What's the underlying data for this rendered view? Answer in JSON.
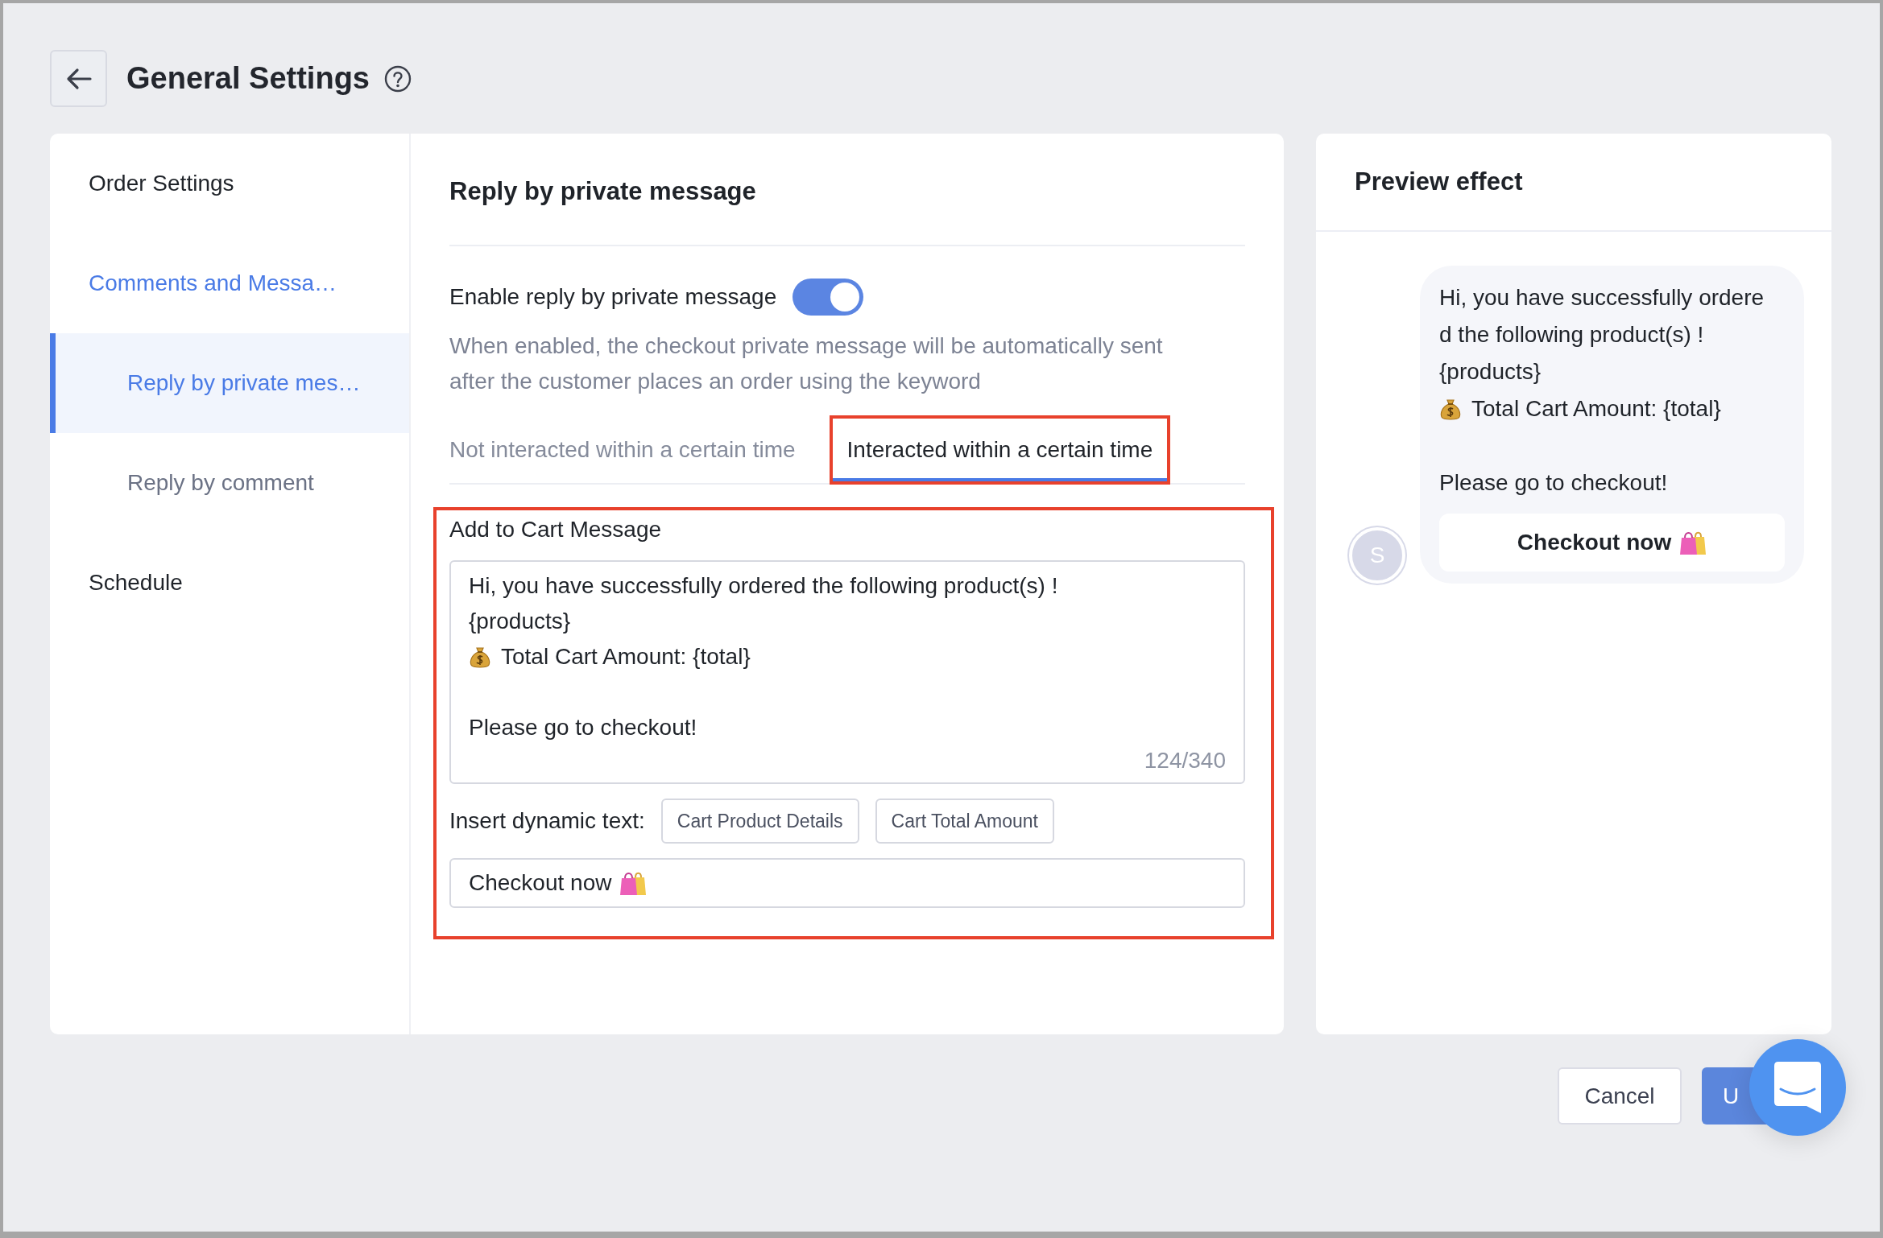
{
  "header": {
    "title": "General Settings"
  },
  "sidebar": {
    "items": [
      {
        "label": "Order Settings",
        "kind": "group",
        "selected": false
      },
      {
        "label": "Comments and Messa…",
        "kind": "group-active",
        "selected": false
      },
      {
        "label": "Reply by private mes…",
        "kind": "sub",
        "selected": true
      },
      {
        "label": "Reply by comment",
        "kind": "sub",
        "selected": false
      },
      {
        "label": "Schedule",
        "kind": "group",
        "selected": false
      }
    ]
  },
  "content": {
    "title": "Reply by private message",
    "toggle": {
      "label": "Enable reply by private message",
      "on": true
    },
    "description": [
      "When enabled, the checkout private message will be automatically sent",
      "after the customer places an order using the keyword"
    ],
    "tabs": [
      {
        "label": "Not interacted within a certain time",
        "selected": false,
        "highlighted": false
      },
      {
        "label": "Interacted within a certain time",
        "selected": true,
        "highlighted": true
      }
    ],
    "cart_message": {
      "label": "Add to Cart Message",
      "highlighted": true,
      "lines": [
        {
          "kind": "text",
          "text": "Hi, you have successfully ordered the following product(s) !"
        },
        {
          "kind": "text",
          "text": "{products}"
        },
        {
          "kind": "money",
          "text": "Total Cart Amount: {total}"
        },
        {
          "kind": "blank"
        },
        {
          "kind": "text",
          "text": "Please go to checkout!"
        }
      ],
      "counter": "124/340",
      "dynamic_label": "Insert dynamic text:",
      "dynamic_buttons": [
        "Cart Product Details",
        "Cart Total Amount"
      ],
      "button_text": "Checkout now"
    }
  },
  "preview": {
    "title": "Preview effect",
    "avatar": "S",
    "lines": [
      {
        "kind": "text",
        "text": "Hi, you have successfully ordere"
      },
      {
        "kind": "text",
        "text": "d the following product(s) !"
      },
      {
        "kind": "text",
        "text": "{products}"
      },
      {
        "kind": "money",
        "text": "Total Cart Amount: {total}"
      },
      {
        "kind": "blank"
      },
      {
        "kind": "text",
        "text": "Please go to checkout!"
      }
    ],
    "button": "Checkout now"
  },
  "footer": {
    "cancel": "Cancel",
    "submit": "U"
  }
}
